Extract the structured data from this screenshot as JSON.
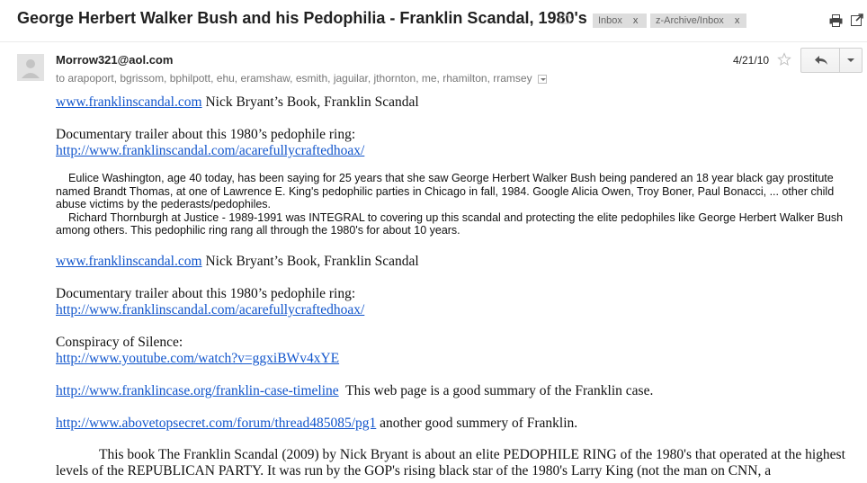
{
  "thread": {
    "subject": "George Herbert Walker Bush and his Pedophilia - Franklin Scandal, 1980's",
    "labels": [
      {
        "name": "Inbox",
        "remove": "x"
      },
      {
        "name": "z-Archive/Inbox",
        "remove": "x"
      }
    ]
  },
  "message": {
    "sender": "Morrow321@aol.com",
    "recipients": "to arapoport, bgrissom, bphilpott, ehu, eramshaw, esmith, jaguilar, jthornton, me, rhamilton, rramsey",
    "date": "4/21/10",
    "icons": [
      "label-tag-icon",
      "print-icon",
      "new-window-icon",
      "star-icon",
      "reply-icon",
      "more-icon",
      "avatar"
    ]
  },
  "body": {
    "link_site": "www.franklinscandal.com",
    "book_text": " Nick Bryant’s Book, Franklin Scandal",
    "trailer_text": "Documentary trailer about this 1980’s pedophile ring:",
    "trailer_link": "http://www.franklinscandal.com/acarefullycraftedhoax/",
    "para1": "Eulice Washington, age 40 today, has been saying for 25 years that she saw George Herbert Walker Bush being pandered an 18 year black gay prostitute named Brandt Thomas, at one of Lawrence E. King's pedophilic parties in Chicago in fall, 1984. Google Alicia Owen, Troy Boner, Paul Bonacci, ... other child abuse victims by the pederasts/pedophiles.",
    "para2": "Richard Thornburgh at Justice - 1989-1991 was INTEGRAL to covering up this scandal and protecting the elite pedophiles like George Herbert Walker Bush among others. This pedophilic ring rang all through the 1980's for about 10 years.",
    "conspiracy_text": "Conspiracy of Silence:",
    "youtube_link": "http://www.youtube.com/watch?v=ggxiBWv4xYE",
    "timeline_link": "http://www.franklincase.org/franklin-case-timeline",
    "timeline_text": "  This web page is a good summary of the Franklin case.",
    "ats_link": "http://www.abovetopsecret.com/forum/thread485085/pg1",
    "ats_text": " another good summery of Franklin.",
    "book_para": "This book The Franklin Scandal (2009) by Nick Bryant is about an elite PEDOPHILE RING of the 1980's that operated at the highest levels of the REPUBLICAN PARTY. It was run by the GOP's rising black star of the 1980's Larry King (not the man on CNN, a"
  }
}
